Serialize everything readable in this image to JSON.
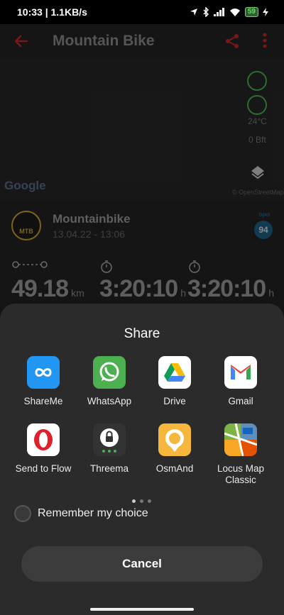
{
  "status_bar": {
    "time_speed": "10:33 | 1.1KB/s",
    "battery": "59"
  },
  "app": {
    "title": "Mountain Bike",
    "google_logo": "Google",
    "map_attribution": "© OpenStreetMap",
    "temperature": "24°C",
    "wind": "0 Bft",
    "activity_name": "Mountainbike",
    "activity_date": "13.04.22 - 13:06",
    "sport_badge": "MTB",
    "hr_label": "bpm",
    "hr_value": "94",
    "stats": [
      {
        "value": "49.18",
        "unit": "km"
      },
      {
        "value": "3:20:10",
        "unit": "h"
      },
      {
        "value": "3:20:10",
        "unit": "h"
      }
    ]
  },
  "share_sheet": {
    "title": "Share",
    "apps": [
      {
        "label": "ShareMe",
        "icon": "shareme-icon"
      },
      {
        "label": "WhatsApp",
        "icon": "whatsapp-icon"
      },
      {
        "label": "Drive",
        "icon": "drive-icon"
      },
      {
        "label": "Gmail",
        "icon": "gmail-icon"
      },
      {
        "label": "Send to Flow",
        "icon": "opera-icon"
      },
      {
        "label": "Threema",
        "icon": "threema-icon"
      },
      {
        "label": "OsmAnd",
        "icon": "osmand-icon"
      },
      {
        "label": "Locus Map Classic",
        "icon": "locus-map-icon"
      }
    ],
    "remember_label": "Remember my choice",
    "cancel_label": "Cancel"
  },
  "colors": {
    "accent_red": "#c62828",
    "sheet_bg": "#2b2b2b",
    "whatsapp": "#4caf50",
    "shareme": "#2196f3"
  }
}
